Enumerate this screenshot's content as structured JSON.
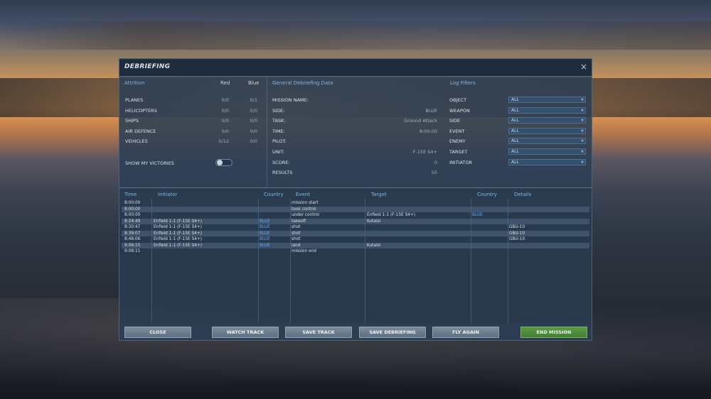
{
  "window": {
    "title": "DEBRIEFING",
    "close_glyph": "×"
  },
  "attrition": {
    "heading": "Attrition",
    "col_red": "Red",
    "col_blue": "Blue",
    "rows": [
      {
        "label": "PLANES",
        "red": "0/0",
        "blue": "0/1"
      },
      {
        "label": "HELICOPTERS",
        "red": "0/0",
        "blue": "0/0"
      },
      {
        "label": "SHIPS",
        "red": "0/0",
        "blue": "0/0"
      },
      {
        "label": "AIR DEFENCE",
        "red": "0/0",
        "blue": "0/0"
      },
      {
        "label": "VEHICLES",
        "red": "0/12",
        "blue": "0/0"
      }
    ],
    "show_victories_label": "SHOW MY VICTORIES",
    "show_victories_on": false
  },
  "general": {
    "heading": "General Debriefing Data",
    "rows": [
      {
        "label": "MISSION NAME:",
        "value": ""
      },
      {
        "label": "SIDE:",
        "value": "BLUE"
      },
      {
        "label": "TASK:",
        "value": "Ground Attack"
      },
      {
        "label": "TIME:",
        "value": "8:00:00"
      },
      {
        "label": "PILOT:",
        "value": ""
      },
      {
        "label": "UNIT:",
        "value": "F-15E S4+"
      },
      {
        "label": "SCORE:",
        "value": "0"
      },
      {
        "label": "RESULTS",
        "value": "50"
      }
    ]
  },
  "filters": {
    "heading": "Log Filters",
    "rows": [
      {
        "label": "OBJECT",
        "value": "ALL"
      },
      {
        "label": "WEAPON",
        "value": "ALL"
      },
      {
        "label": "SIDE",
        "value": "ALL"
      },
      {
        "label": "EVENT",
        "value": "ALL"
      },
      {
        "label": "ENEMY",
        "value": "ALL"
      },
      {
        "label": "TARGET",
        "value": "ALL"
      },
      {
        "label": "INITIATOR",
        "value": "ALL"
      }
    ]
  },
  "log": {
    "headers": {
      "time": "Time",
      "initiator": "Initiator",
      "country": "Country",
      "event": "Event",
      "target": "Target",
      "country2": "Country",
      "details": "Details"
    },
    "rows": [
      {
        "time": "8:00:00",
        "initiator": "",
        "country": "",
        "event": "mission start",
        "target": "",
        "country2": "",
        "details": ""
      },
      {
        "time": "8:00:00",
        "initiator": "",
        "country": "",
        "event": "took control",
        "target": "",
        "country2": "",
        "details": ""
      },
      {
        "time": "8:00:00",
        "initiator": "",
        "country": "",
        "event": "under control",
        "target": "Enfield 1-1 (F-15E S4+)",
        "country2": "BLUE",
        "details": ""
      },
      {
        "time": "8:24:49",
        "initiator": "Enfield 1-1 (F-15E S4+)",
        "country": "BLUE",
        "event": "takeoff",
        "target": "Kutaisi",
        "country2": "",
        "details": ""
      },
      {
        "time": "8:30:47",
        "initiator": "Enfield 1-1 (F-15E S4+)",
        "country": "BLUE",
        "event": "shot",
        "target": "",
        "country2": "",
        "details": "GBU-10"
      },
      {
        "time": "8:39:07",
        "initiator": "Enfield 1-1 (F-15E S4+)",
        "country": "BLUE",
        "event": "shot",
        "target": "",
        "country2": "",
        "details": "GBU-10"
      },
      {
        "time": "8:48:06",
        "initiator": "Enfield 1-1 (F-15E S4+)",
        "country": "BLUE",
        "event": "shot",
        "target": "",
        "country2": "",
        "details": "GBU-10"
      },
      {
        "time": "9:06:15",
        "initiator": "Enfield 1-1 (F-15E S4+)",
        "country": "BLUE",
        "event": "land",
        "target": "Kutaisi",
        "country2": "",
        "details": ""
      },
      {
        "time": "9:08:11",
        "initiator": "",
        "country": "",
        "event": "mission end",
        "target": "",
        "country2": "",
        "details": ""
      }
    ]
  },
  "buttons": {
    "close": "CLOSE",
    "watch_track": "WATCH TRACK",
    "save_track": "SAVE TRACK",
    "save_debriefing": "SAVE DEBRIEFING",
    "fly_again": "FLY AGAIN",
    "end_mission": "END MISSION"
  },
  "colors": {
    "accent": "#7fb8e2",
    "blue_country": "#5fa6ee",
    "end_mission": "#5b9a45"
  },
  "icons": {
    "close": "close-icon",
    "dropdown": "chevron-down-icon"
  }
}
